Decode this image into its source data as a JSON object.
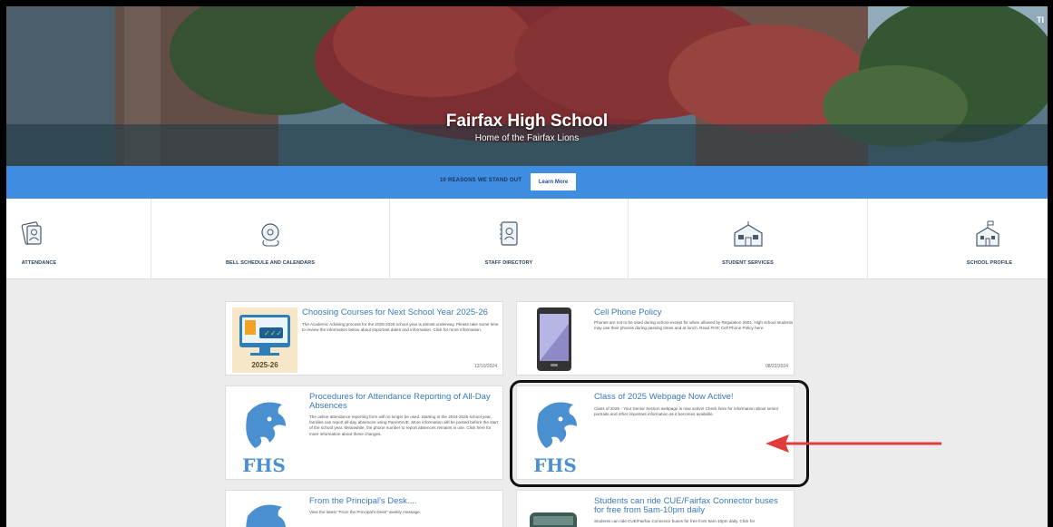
{
  "hero": {
    "title": "Fairfax High School",
    "subtitle": "Home of the Fairfax Lions",
    "corner": "TI"
  },
  "banner": {
    "text": "10 REASONS WE STAND OUT",
    "button": "Learn More"
  },
  "quicklinks": [
    {
      "label": "ATTENDANCE",
      "icon": "attendance-icon"
    },
    {
      "label": "BELL SCHEDULE AND CALENDARS",
      "icon": "bell-icon"
    },
    {
      "label": "STAFF DIRECTORY",
      "icon": "directory-icon"
    },
    {
      "label": "STUDENT SERVICES",
      "icon": "student-services-icon"
    },
    {
      "label": "SCHOOL PROFILE",
      "icon": "school-profile-icon"
    }
  ],
  "news": [
    {
      "title": "Choosing Courses for Next School Year 2025-26",
      "text": "The Academic Advising process for the 2025-2026 school year is almost underway. Please take some time to review the information below about important dates and information. Click for more information.",
      "date": "12/10/2024",
      "thumb_label": "2025-26"
    },
    {
      "title": "Cell Phone Policy",
      "text": "Phones are not to be used during school except for when allowed by Regulation 2601. High school students may use their phones during passing times and at lunch. Read FHS' Cell Phone Policy here.",
      "date": "08/22/2024"
    },
    {
      "title": "Procedures for Attendance Reporting of All-Day Absences",
      "text": "The online attendance reporting form will no longer be used. Starting in the 2024-2025 school year, families can report all-day absences using ParentVUE. More information will be posted before the start of the school year. Meanwhile, the phone number to report absences remains in use. Click here for more information about these changes.",
      "thumb_label": "FHS"
    },
    {
      "title": "Class of 2025 Webpage Now Active!",
      "text": "Class of 2025 - Your Senior Section webpage is now active! Check here for information about senior portraits and other important information as it becomes available.",
      "thumb_label": "FHS"
    },
    {
      "title": "From the Principal's Desk....",
      "text": "View the latest \"From the Principal's Desk\" weekly message."
    },
    {
      "title": "Students can ride CUE/Fairfax Connector buses for free from 5am-10pm daily",
      "text": "Students can ride CUE/Fairfax Connector buses for free from 5am-10pm daily. Click for"
    }
  ],
  "colors": {
    "banner": "#3f8de0",
    "link": "#3a79b6",
    "arrow": "#e23b3b",
    "lion": "#4a90d0"
  }
}
